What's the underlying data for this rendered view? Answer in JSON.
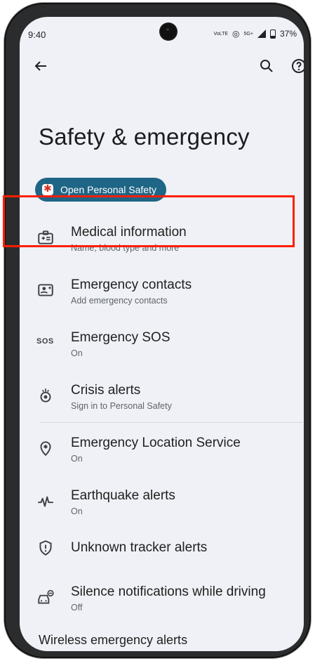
{
  "status_bar": {
    "time": "9:40",
    "network_small": "VoLTE",
    "signal_label": "5G+",
    "battery": "37%"
  },
  "toolbar": {
    "back_icon": "arrow-left-icon",
    "search_icon": "search-icon",
    "help_icon": "help-icon"
  },
  "page": {
    "title": "Safety & emergency",
    "chip_label": "Open Personal Safety"
  },
  "items": [
    {
      "title": "Medical information",
      "subtitle": "Name, blood type and more",
      "icon": "medical-id-icon"
    },
    {
      "title": "Emergency contacts",
      "subtitle": "Add emergency contacts",
      "icon": "contacts-card-icon"
    },
    {
      "title": "Emergency SOS",
      "subtitle": "On",
      "icon": "sos-icon"
    },
    {
      "title": "Crisis alerts",
      "subtitle": "Sign in to Personal Safety",
      "icon": "crisis-alert-icon"
    },
    {
      "title": "Emergency Location Service",
      "subtitle": "On",
      "icon": "location-pin-icon"
    },
    {
      "title": "Earthquake alerts",
      "subtitle": "On",
      "icon": "pulse-icon"
    },
    {
      "title": "Unknown tracker alerts",
      "subtitle": "",
      "icon": "shield-exclamation-icon"
    },
    {
      "title": "Silence notifications while driving",
      "subtitle": "Off",
      "icon": "car-silence-icon"
    }
  ],
  "footer": {
    "label": "Wireless emergency alerts"
  },
  "colors": {
    "background": "#eff1f6",
    "chip": "#1f6585",
    "highlight": "#ff1f00"
  }
}
